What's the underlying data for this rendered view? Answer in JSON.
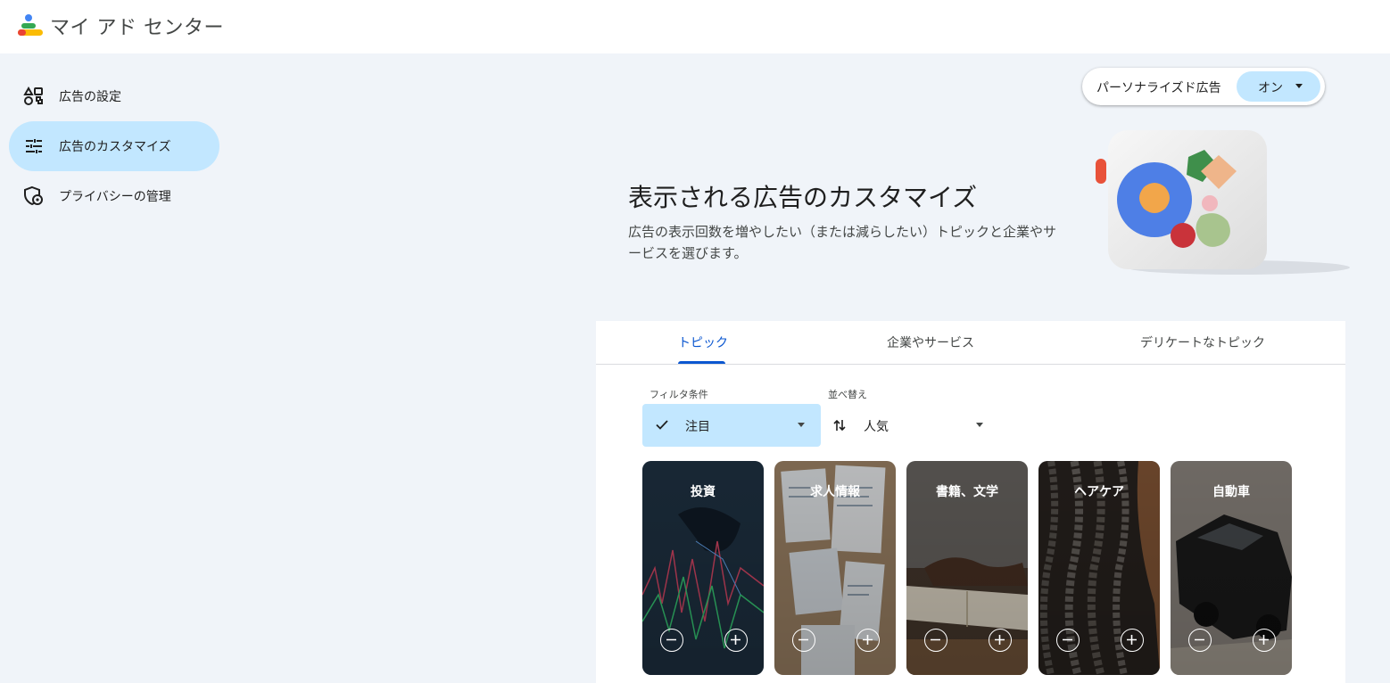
{
  "app": {
    "title": "マイ アド センター",
    "logo_icon": "my-ad-center-logo-icon"
  },
  "sidebar": {
    "items": [
      {
        "label": "広告の設定",
        "icon": "shapes-icon",
        "active": false
      },
      {
        "label": "広告のカスタマイズ",
        "icon": "tune-icon",
        "active": true
      },
      {
        "label": "プライバシーの管理",
        "icon": "privacy-shield-icon",
        "active": false
      }
    ]
  },
  "personalized_ads": {
    "label": "パーソナライズド広告",
    "state": "オン"
  },
  "hero": {
    "title": "表示される広告のカスタマイズ",
    "description": "広告の表示回数を増やしたい（または減らしたい）トピックと企業やサービスを選びます。"
  },
  "tabs": [
    {
      "label": "トピック",
      "active": true
    },
    {
      "label": "企業やサービス",
      "active": false
    },
    {
      "label": "デリケートなトピック",
      "active": false
    }
  ],
  "filter": {
    "label": "フィルタ条件",
    "value": "注目"
  },
  "sort": {
    "label": "並べ替え",
    "value": "人気"
  },
  "cards": [
    {
      "title": "投資"
    },
    {
      "title": "求人情報"
    },
    {
      "title": "書籍、文学"
    },
    {
      "title": "ヘアケア"
    },
    {
      "title": "自動車"
    }
  ],
  "colors": {
    "accent": "#0b57d0",
    "active_bg": "#c2e7ff",
    "surface": "#f0f4f9"
  }
}
